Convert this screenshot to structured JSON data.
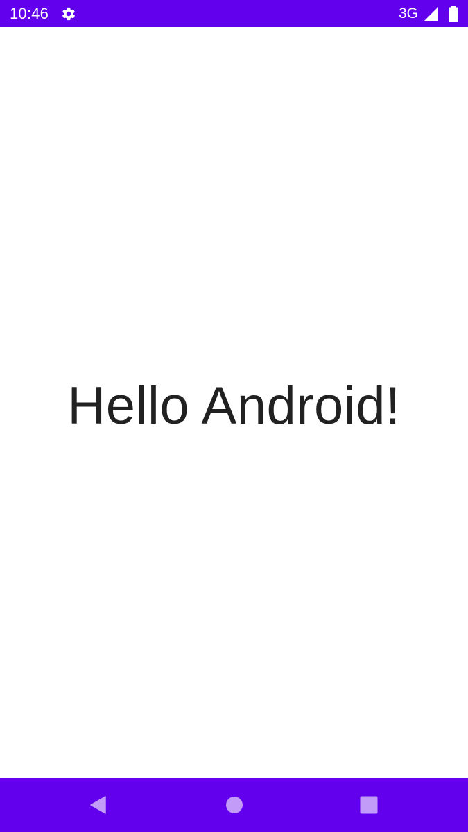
{
  "status_bar": {
    "time": "10:46",
    "network": "3G",
    "settings_icon": "gear-icon",
    "signal_icon": "signal-icon",
    "battery_icon": "battery-icon"
  },
  "main": {
    "greeting": "Hello Android!"
  },
  "nav_bar": {
    "back_icon": "back-triangle-icon",
    "home_icon": "home-circle-icon",
    "recents_icon": "recents-square-icon"
  },
  "colors": {
    "primary": "#6200ee",
    "nav_icon": "#c29af7",
    "text": "#212121",
    "background": "#ffffff"
  }
}
